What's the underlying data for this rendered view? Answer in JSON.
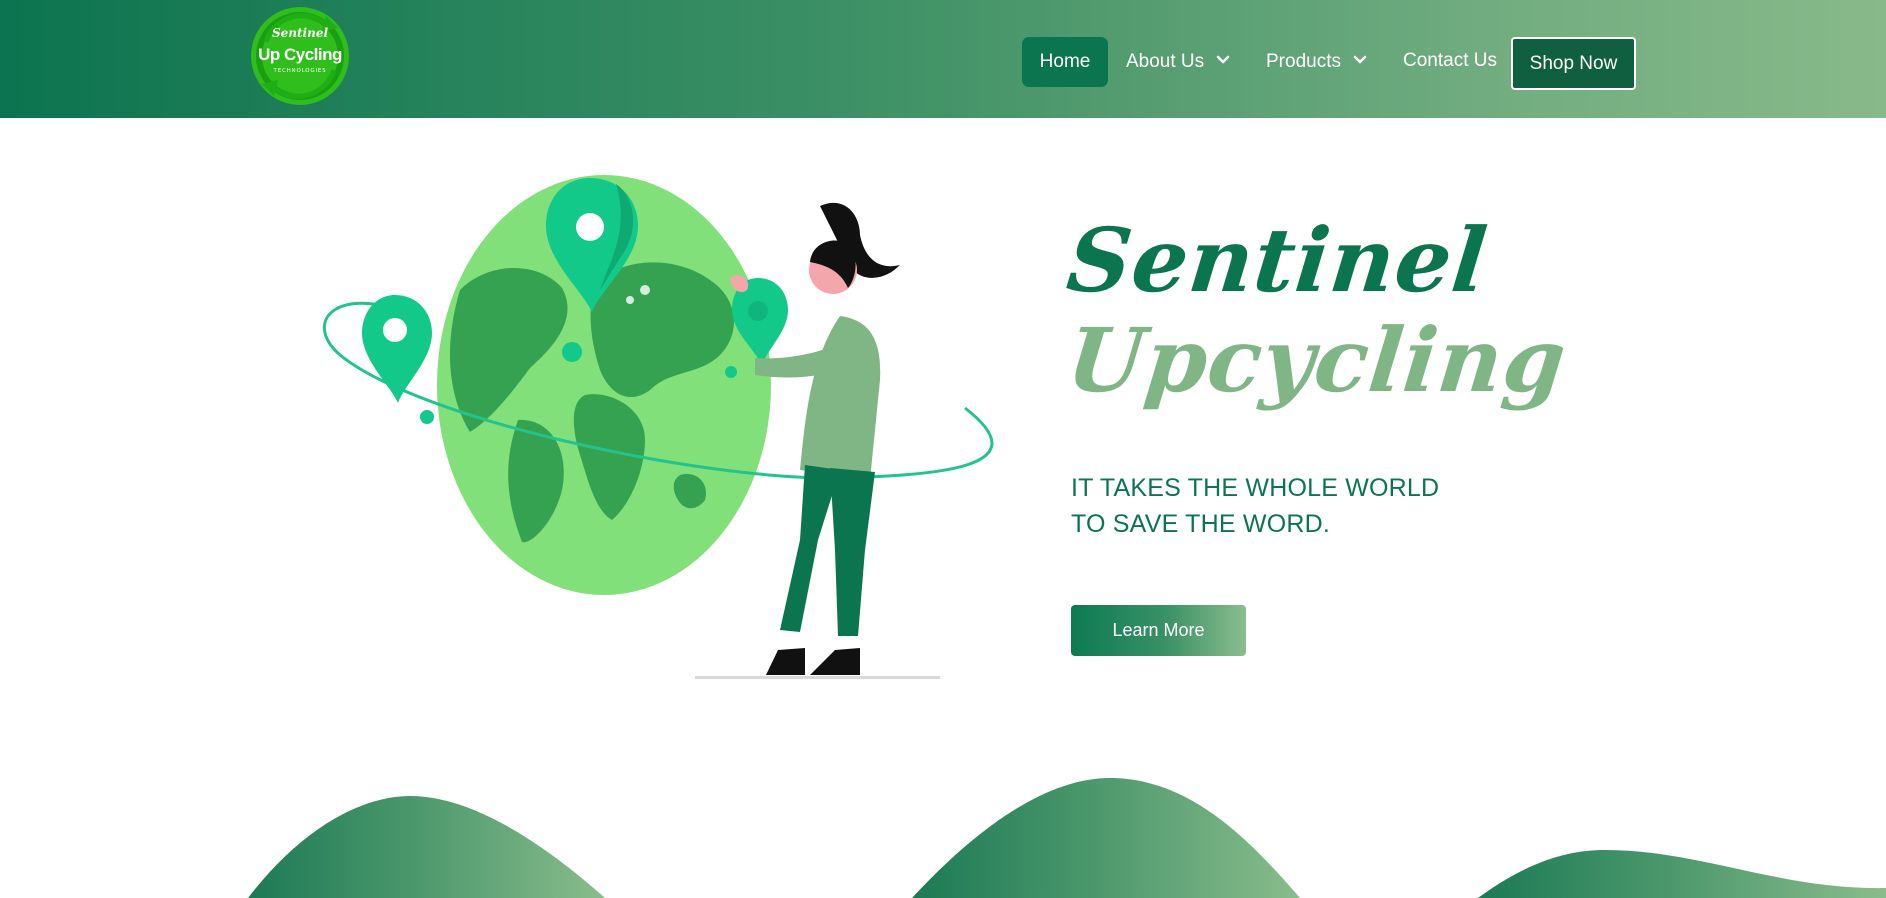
{
  "brand": {
    "logo_line1": "Sentinel",
    "logo_line2": "Up Cycling",
    "logo_line3": "TECHNOLOGIES"
  },
  "nav": {
    "home": "Home",
    "about": "About Us",
    "products": "Products",
    "contact": "Contact Us",
    "shop": "Shop Now"
  },
  "hero": {
    "title_line1": "Sentinel",
    "title_line2": "Upcycling",
    "tagline_line1": "IT TAKES THE WHOLE WORLD",
    "tagline_line2": "TO SAVE THE WORD.",
    "cta": "Learn More"
  },
  "colors": {
    "primary": "#0b7550",
    "accent_light": "#80b585",
    "globe": "#82e07a",
    "continents": "#35a252",
    "pin": "#12c98a"
  },
  "icons": {
    "about_chevron": "chevron-down-icon",
    "products_chevron": "chevron-down-icon"
  }
}
